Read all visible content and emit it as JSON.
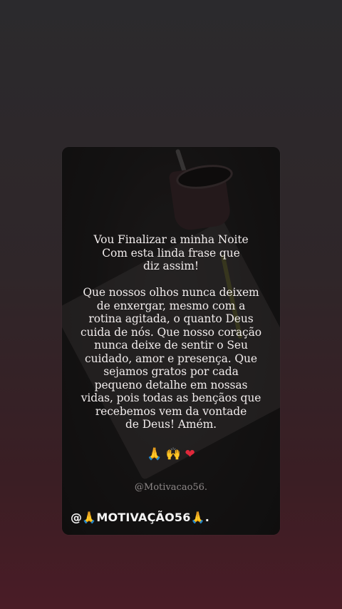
{
  "post": {
    "message": "Vou Finalizar a minha Noite\nCom esta linda frase que\ndiz assim!\n\nQue nossos olhos nunca deixem\nde enxergar, mesmo com a\nrotina agitada, o quanto Deus\ncuida de nós. Que nosso coração\nnunca deixe de sentir o Seu\ncuidado, amor e presença. Que\nsejamos gratos por cada\npequeno detalhe em nossas\nvidas, pois todas as bençãos que\nrecebemos vem da vontade\nde Deus! Amém.",
    "emojis": [
      "🙏",
      "🙌",
      "❤"
    ],
    "watermark": "@Motivacao56.",
    "handle_prefix": "@",
    "handle_name": "MOTIVAÇÃO56",
    "handle_suffix": "."
  },
  "colors": {
    "background_top": "#2b2a2d",
    "background_bottom": "#4a1c26",
    "text": "#f1ecec",
    "heart": "#e0283a"
  }
}
